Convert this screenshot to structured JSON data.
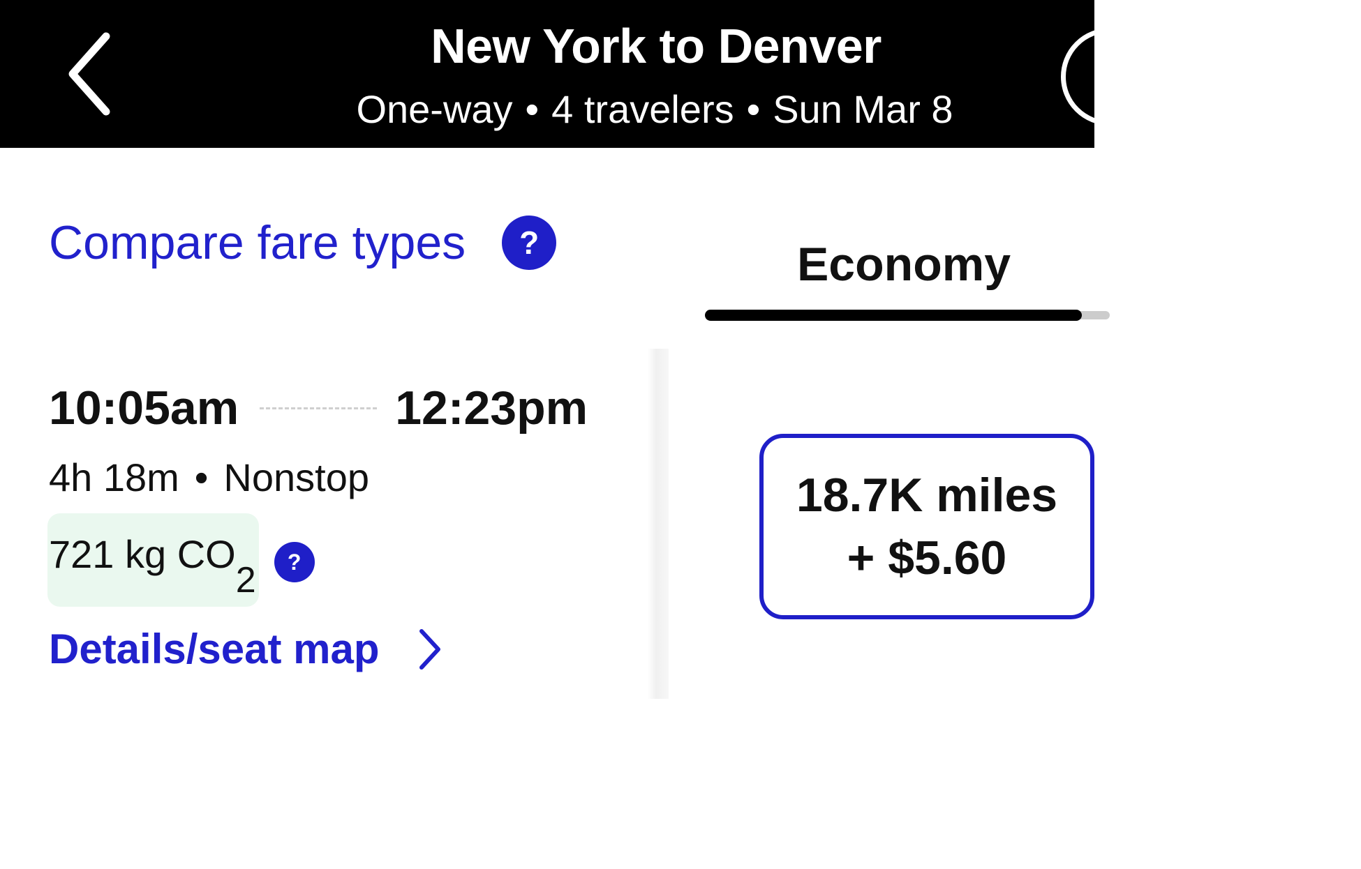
{
  "header": {
    "title": "New York to Denver",
    "trip_type": "One-way",
    "travelers": "4  travelers",
    "date": "Sun Mar 8",
    "separator": "•",
    "back_icon": "chevron-left-icon"
  },
  "compare": {
    "label": "Compare fare types",
    "help_glyph": "?"
  },
  "tabs": [
    {
      "label": "Economy",
      "selected": true
    }
  ],
  "flight": {
    "depart_time": "10:05am",
    "arrive_time": "12:23pm",
    "duration": "4h 18m",
    "stops": "Nonstop",
    "separator": "•",
    "co2_value": "721 kg CO",
    "co2_subscript": "2",
    "co2_help_glyph": "?",
    "details_label": "Details/seat map"
  },
  "fare": {
    "miles": "18.7K miles",
    "cash": "+ $5.60"
  },
  "colors": {
    "header_bg": "#000000",
    "accent_blue": "#1f1fc8",
    "co2_badge_bg": "#eaf8ef"
  }
}
